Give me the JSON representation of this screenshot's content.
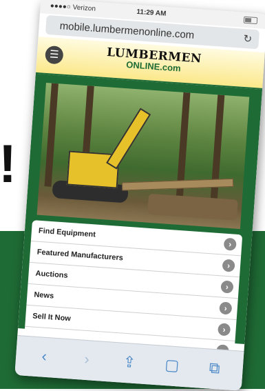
{
  "headline": {
    "exclamation": "!"
  },
  "phone": {
    "status_bar": {
      "carrier": "●●●●○ Verizon",
      "time": "11:29 AM"
    },
    "browser": {
      "url": "mobile.lumbermenonline.com",
      "reload_icon": "reload-icon"
    },
    "site": {
      "logo_line1": "LUMBERMEN",
      "logo_line2": "ONLINE.com",
      "menu_icon": "hamburger-menu-icon"
    },
    "hero_image": "excavator-clearing-forest",
    "menu_items": [
      {
        "label": "Find Equipment"
      },
      {
        "label": "Featured Manufacturers"
      },
      {
        "label": "Auctions"
      },
      {
        "label": "News"
      },
      {
        "label": "Sell It Now"
      },
      {
        "label": ""
      }
    ],
    "toolbar": {
      "back_icon": "back-arrow-icon",
      "forward_icon": "forward-arrow-icon",
      "share_icon": "share-icon",
      "bookmarks_icon": "book-icon",
      "tabs_icon": "tabs-icon"
    }
  },
  "colors": {
    "brand_green": "#1f6b35",
    "header_yellow": "#fbe88a",
    "ios_blue": "#4a88c7"
  }
}
